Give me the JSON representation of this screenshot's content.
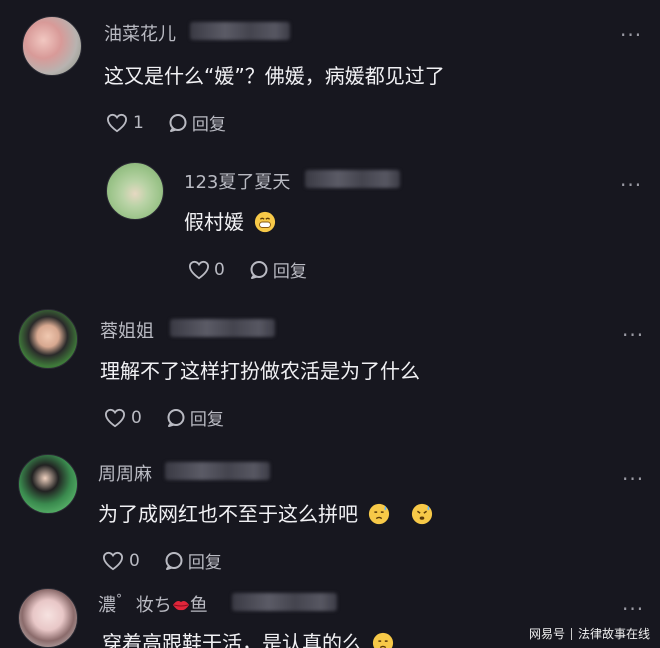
{
  "comments": [
    {
      "username": "油菜花儿",
      "text": "这又是什么“媛”？佛媛，病媛都见过了",
      "likes": "1",
      "reply_label": "回复",
      "more_icon": "more-dots-icon"
    },
    {
      "username": "123夏了夏天",
      "text": "假村媛",
      "likes": "0",
      "reply_label": "回复",
      "emoji": "grinning-emoji"
    },
    {
      "username": "蓉姐姐",
      "text": "理解不了这样打扮做农活是为了什么",
      "likes": "0",
      "reply_label": "回复"
    },
    {
      "username": "周周麻",
      "text": "为了成网红也不至于这么拼吧",
      "likes": "0",
      "reply_label": "回复",
      "emoji": "sweat-emoji"
    },
    {
      "username_part1": "濃",
      "username_part2": "妆ち",
      "username_part3": "鱼",
      "text": "穿着高跟鞋干活，是认真的么",
      "emoji": "sweat-emoji"
    }
  ],
  "watermark": {
    "brand": "网易号",
    "channel": "法律故事在线"
  },
  "colors": {
    "background": "#17171f",
    "username": "#b9bac2",
    "text": "#f1f1f4"
  }
}
